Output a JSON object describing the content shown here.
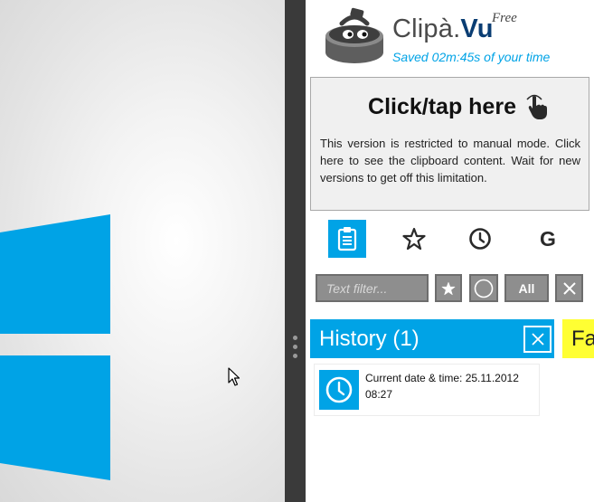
{
  "app": {
    "name_prefix": "Clipà.",
    "name_suffix": "Vu",
    "edition": "Free",
    "saved_time": "Saved 02m:45s of your time"
  },
  "tap_panel": {
    "title": "Click/tap here",
    "description": "This version is restricted to manual mode. Click here to see the clipboard content. Wait for new versions to get off this limitation."
  },
  "tabs": [
    {
      "icon": "clipboard-icon",
      "active": true
    },
    {
      "icon": "star-icon",
      "active": false
    },
    {
      "icon": "clock-icon",
      "active": false
    },
    {
      "icon": "google-icon",
      "label": "G",
      "active": false
    }
  ],
  "filter": {
    "placeholder": "Text filter...",
    "all_label": "All"
  },
  "history": {
    "title": "History (1)",
    "items": [
      {
        "icon": "clock-icon",
        "text": "Current date & time: 25.11.2012 08:27"
      }
    ]
  },
  "favorites": {
    "title": "Favorites"
  },
  "colors": {
    "accent": "#00a3e6",
    "favorites": "#ffff33",
    "splitter": "#3a3a3a",
    "filter_bg": "#8e8e8e"
  }
}
